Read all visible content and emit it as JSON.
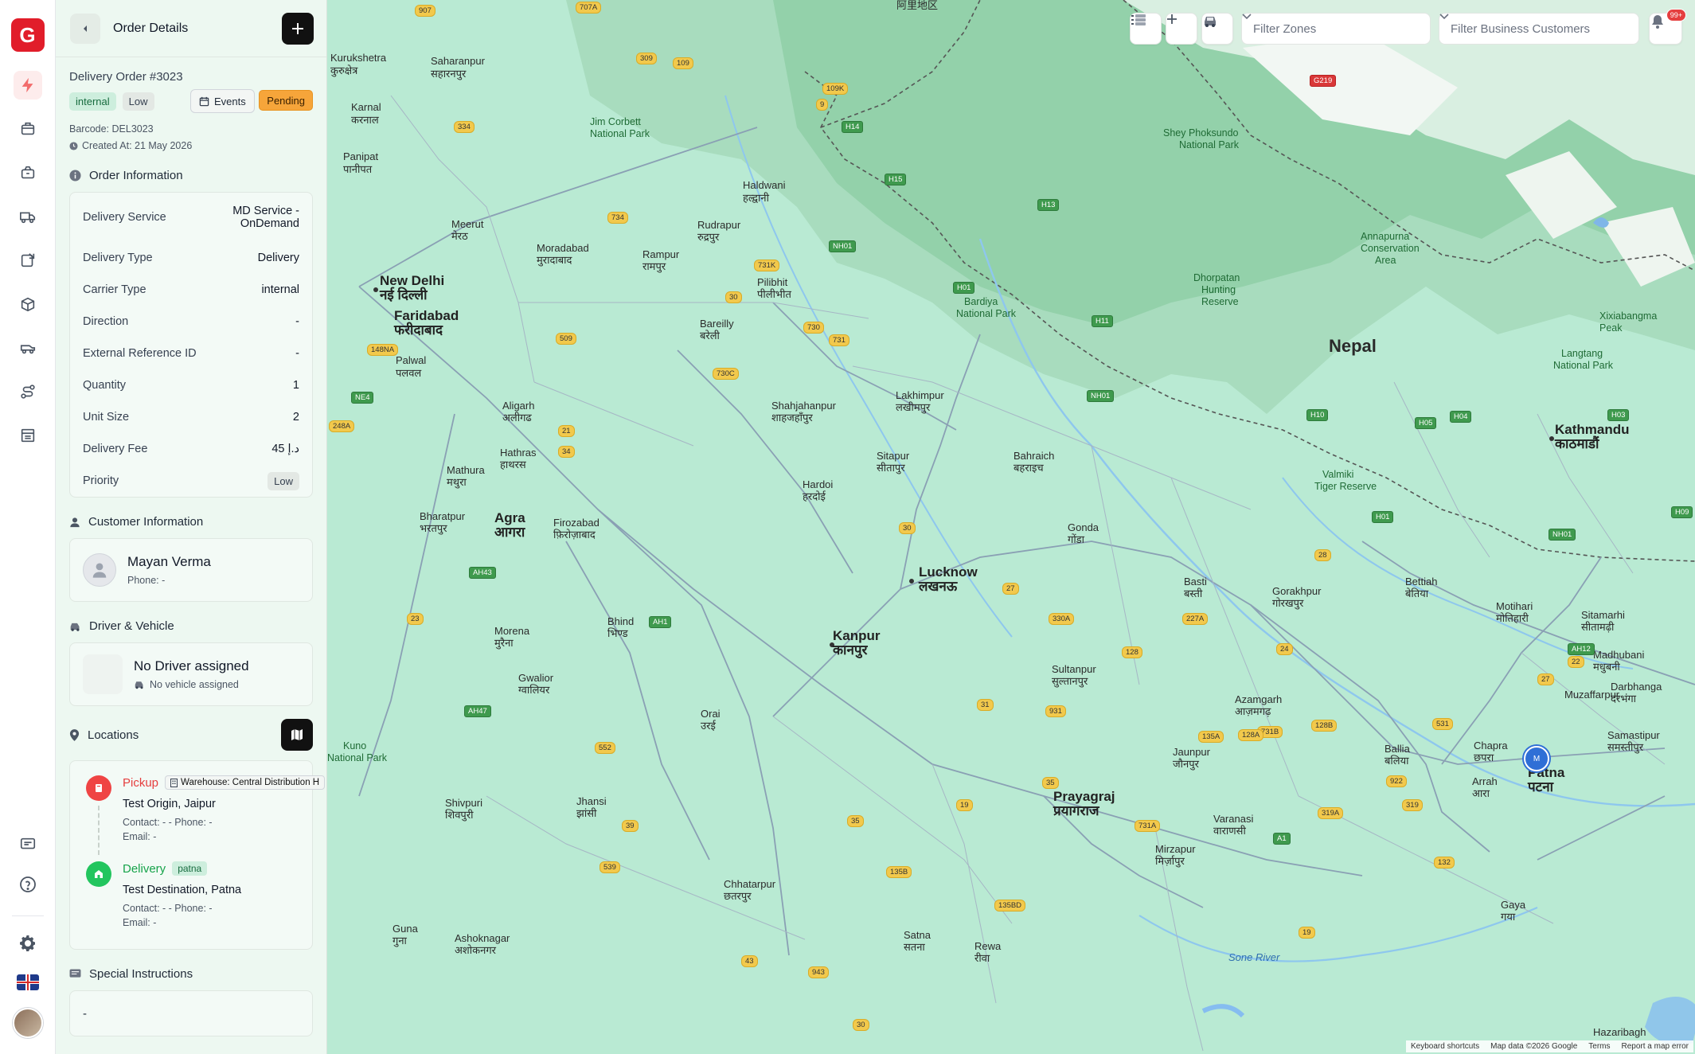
{
  "rail": {
    "logo_letter": "G",
    "nav_icons": [
      "lightning-icon",
      "delivery-box-icon",
      "package-return-icon",
      "delivery-truck-icon",
      "dispatch-icon",
      "inventory-boxes-icon",
      "fleet-icon",
      "route-icon",
      "warehouse-icon"
    ],
    "bottom_icons": [
      "chat-icon",
      "help-icon",
      "settings-icon",
      "uk-flag-icon",
      "user-avatar"
    ]
  },
  "panel": {
    "title": "Order Details",
    "order_number": "Delivery Order #3023",
    "carrier_tag": "internal",
    "priority_tag": "Low",
    "events_label": "Events",
    "status": "Pending",
    "barcode": "Barcode: DEL3023",
    "created_at": "Created At: 21 May 2026"
  },
  "order_info": {
    "title": "Order Information",
    "delivery_service_label": "Delivery Service",
    "delivery_service_line1": "MD Service -",
    "delivery_service_line2": "OnDemand",
    "rows": [
      {
        "label": "Delivery Type",
        "value": "Delivery"
      },
      {
        "label": "Carrier Type",
        "value": "internal"
      },
      {
        "label": "Direction",
        "value": "-"
      },
      {
        "label": "External Reference ID",
        "value": "-"
      },
      {
        "label": "Quantity",
        "value": "1"
      },
      {
        "label": "Unit Size",
        "value": "2"
      },
      {
        "label": "Delivery Fee",
        "value": "45 د.إ"
      }
    ],
    "priority_label": "Priority",
    "priority_value": "Low"
  },
  "customer": {
    "title": "Customer Information",
    "name": "Mayan Verma",
    "phone": "Phone: -"
  },
  "driver": {
    "title": "Driver & Vehicle",
    "name": "No Driver assigned",
    "vehicle": "No vehicle assigned"
  },
  "locations": {
    "title": "Locations",
    "pickup": {
      "type": "Pickup",
      "warehouse": "Warehouse: Central Distribution H",
      "address": "Test Origin, Jaipur",
      "contact": "Contact: - - Phone: -",
      "email": "Email: -"
    },
    "delivery": {
      "type": "Delivery",
      "zone": "patna",
      "address": "Test Destination, Patna",
      "contact": "Contact: - - Phone: -",
      "email": "Email: -"
    }
  },
  "special": {
    "title": "Special Instructions",
    "value": "-"
  },
  "map_controls": {
    "filter_zones": "Filter Zones",
    "filter_customers": "Filter Business Customers",
    "notifications": "99+",
    "marker_label": "M"
  },
  "map_labels": {
    "nepal": "Nepal",
    "new_delhi": "New Delhi",
    "new_delhi_hi": "नई दिल्ली",
    "faridabad": "Faridabad",
    "faridabad_hi": "फरीदाबाद",
    "lucknow": "Lucknow",
    "lucknow_hi": "लखनऊ",
    "kanpur": "Kanpur",
    "kanpur_hi": "कानपुर",
    "patna": "Patna",
    "patna_hi": "पटना",
    "kathmandu": "Kathmandu",
    "kathmandu_hi": "काठमाडौं",
    "agra": "Agra",
    "agra_hi": "आगरा",
    "meerut": "Meerut",
    "meerut_hi": "मेरठ",
    "moradabad": "Moradabad",
    "moradabad_hi": "मुरादाबाद",
    "bareilly": "Bareilly",
    "bareilly_hi": "बरेली",
    "aligarh": "Aligarh",
    "aligarh_hi": "अलीगढ",
    "mathura": "Mathura",
    "mathura_hi": "मथुरा",
    "gwalior": "Gwalior",
    "gwalior_hi": "ग्वालियर",
    "jhansi": "Jhansi",
    "jhansi_hi": "झांसी",
    "prayagraj": "Prayagraj",
    "prayagraj_hi": "प्रयागराज",
    "varanasi": "Varanasi",
    "varanasi_hi": "वाराणसी",
    "gorakhpur": "Gorakhpur",
    "gorakhpur_hi": "गोरखपुर",
    "haldwani": "Haldwani",
    "haldwani_hi": "हल्द्वानी",
    "rudrapur": "Rudrapur",
    "rudrapur_hi": "रुद्रपुर",
    "sitapur": "Sitapur",
    "sitapur_hi": "सीतापुर",
    "hardoi": "Hardoi",
    "hardoi_hi": "हरदोई",
    "bahraich": "Bahraich",
    "bahraich_hi": "बहराइच",
    "gonda": "Gonda",
    "gonda_hi": "गोंडा",
    "basti": "Basti",
    "basti_hi": "बस्ती",
    "sultanpur": "Sultanpur",
    "sultanpur_hi": "सुल्तानपुर",
    "azamgarh": "Azamgarh",
    "azamgarh_hi": "आज़मगढ़",
    "jaunpur": "Jaunpur",
    "jaunpur_hi": "जौनपुर",
    "mirzapur": "Mirzapur",
    "mirzapur_hi": "मिर्ज़ापुर",
    "satna": "Satna",
    "satna_hi": "सतना",
    "rewa": "Rewa",
    "rewa_hi": "रीवा",
    "chhatarpur": "Chhatarpur",
    "chhatarpur_hi": "छतरपुर",
    "gaya": "Gaya",
    "gaya_hi": "गया",
    "arrah": "Arrah",
    "arrah_hi": "आरा",
    "ballia": "Ballia",
    "ballia_hi": "बलिया",
    "chapra": "Chapra",
    "chapra_hi": "छपरा",
    "motihari": "Motihari",
    "motihari_hi": "मोतिहारी",
    "bettiah": "Bettiah",
    "bettiah_hi": "बेतिया",
    "muzaffarpur": "Muzaffarpur",
    "madhubani": "Madhubani",
    "madhubani_hi": "मधुबनी",
    "darbhanga": "Darbhanga",
    "darbhanga_hi": "दरभंगा",
    "samastipur": "Samastipur",
    "samastipur_hi": "समस्तीपुर",
    "sitamarhi": "Sitamarhi",
    "sitamarhi_hi": "सीतामढ़ी",
    "hazaribagh": "Hazaribagh",
    "shahjahanpur": "Shahjahanpur",
    "shahjahanpur_hi": "शाहजहाँपुर",
    "lakhimpur": "Lakhimpur",
    "lakhimpur_hi": "लखीमपुर",
    "pilibhit": "Pilibhit",
    "pilibhit_hi": "पीलीभीत",
    "rampur": "Rampur",
    "rampur_hi": "रामपुर",
    "saharanpur": "Saharanpur",
    "saharanpur_hi": "सहारनपुर",
    "kurukshetra": "Kurukshetra",
    "kurukshetra_hi": "कुरुक्षेत्र",
    "karnal": "Karnal",
    "karnal_hi": "करनाल",
    "panipat": "Panipat",
    "panipat_hi": "पानीपत",
    "palwal": "Palwal",
    "palwal_hi": "पलवल",
    "firozabad": "Firozabad",
    "firozabad_hi": "फ़िरोज़ाबाद",
    "bharatpur": "Bharatpur",
    "bharatpur_hi": "भरतपुर",
    "hathras": "Hathras",
    "hathras_hi": "हाथरस",
    "bhind": "Bhind",
    "bhind_hi": "भिण्ड",
    "morena": "Morena",
    "morena_hi": "मुरैना",
    "orai": "Orai",
    "orai_hi": "उरई",
    "shivpuri": "Shivpuri",
    "shivpuri_hi": "शिवपुरी",
    "guna": "Guna",
    "guna_hi": "गुना",
    "ashoknagar": "Ashoknagar",
    "ashoknagar_hi": "अशोकनगर",
    "kuno": "Kuno",
    "kuno2": "National Park",
    "jim_corbett": "Jim Corbett",
    "jim_corbett2": "National Park",
    "bardiya": "Bardiya",
    "bardiya2": "National Park",
    "shey": "Shey Phoksundo",
    "shey2": "National Park",
    "annapurna": "Annapurna",
    "annapurna2": "Conservation",
    "annapurna3": "Area",
    "dhorpatan": "Dhorpatan",
    "dhorpatan2": "Hunting",
    "dhorpatan3": "Reserve",
    "valmiki": "Valmiki",
    "valmiki2": "Tiger Reserve",
    "langtang": "Langtang",
    "langtang2": "National Park",
    "xixiabangma": "Xixiabangma",
    "xixiabangma2": "Peak",
    "sone_river": "Sone River",
    "ngari": "阿里地区"
  },
  "map_routes": [
    "907",
    "707A",
    "334",
    "309",
    "109",
    "734",
    "109K",
    "9",
    "H14",
    "H15",
    "H13",
    "731K",
    "NH01",
    "H01",
    "730",
    "731",
    "730C",
    "30",
    "509",
    "148NA",
    "NE4",
    "248A",
    "21",
    "34",
    "30",
    "H11",
    "NH01",
    "H10",
    "H05",
    "H04",
    "H03",
    "27",
    "128",
    "227A",
    "330A",
    "931",
    "31",
    "35",
    "19",
    "731A",
    "731B",
    "135A",
    "128A",
    "128B",
    "319",
    "319A",
    "922",
    "531",
    "28",
    "22",
    "27",
    "24",
    "132",
    "A1",
    "AH1",
    "AH12",
    "AH43",
    "AH47",
    "552",
    "23",
    "35",
    "39",
    "539",
    "135B",
    "135BD",
    "943",
    "30",
    "19",
    "43",
    "H01",
    "H09",
    "NH01",
    "G219"
  ],
  "attribution": {
    "shortcuts": "Keyboard shortcuts",
    "data": "Map data ©2026 Google",
    "terms": "Terms",
    "report": "Report a map error"
  }
}
